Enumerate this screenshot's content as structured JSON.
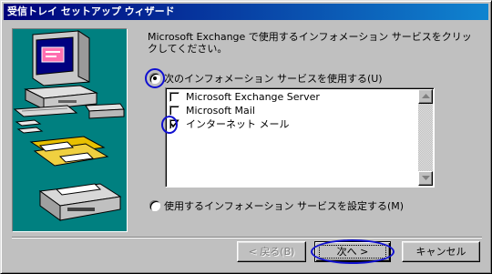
{
  "window": {
    "title": "受信トレイ セットアップ ウィザード"
  },
  "description": "Microsoft Exchange で使用するインフォメーション サービスをクリックしてください。",
  "options": {
    "use_following": "次のインフォメーション サービスを使用する(U)",
    "use_following_selected": true,
    "manual_setup": "使用するインフォメーション サービスを設定する(M)",
    "manual_setup_selected": false
  },
  "services": [
    {
      "label": "Microsoft Exchange Server",
      "checked": false
    },
    {
      "label": "Microsoft Mail",
      "checked": false
    },
    {
      "label": "インターネット メール",
      "checked": true
    }
  ],
  "buttons": {
    "back": "< 戻る(B)",
    "next": "次へ >",
    "cancel": "キャンセル"
  },
  "icons": {
    "scroll_up": "arrow-up-icon",
    "scroll_down": "arrow-down-icon",
    "check": "checkmark-icon",
    "illustration": "computer-mail-printer-illustration"
  },
  "colors": {
    "title_start": "#00007b",
    "title_end": "#1084d0",
    "art_background": "#008080",
    "annotation": "#1010d0"
  }
}
